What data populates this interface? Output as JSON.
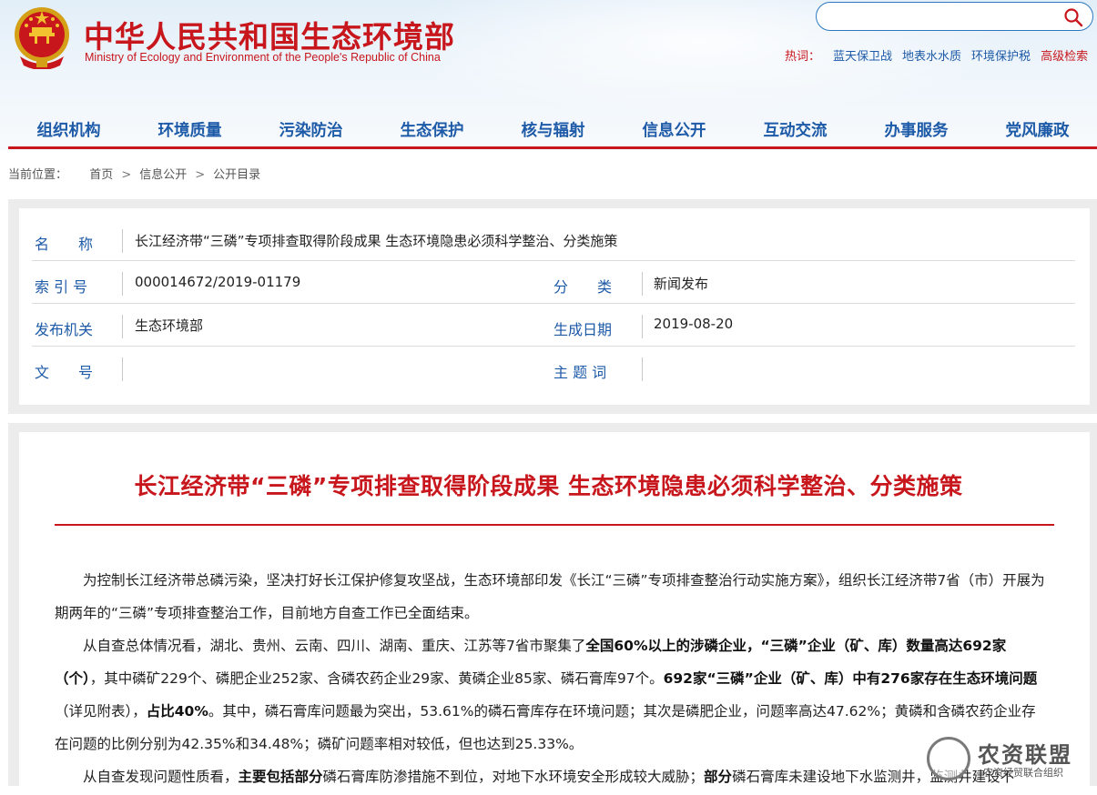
{
  "header": {
    "title_cn": "中华人民共和国生态环境部",
    "title_en": "Ministry of Ecology and Environment of the People's Republic of China",
    "search_placeholder": "",
    "hot_label": "热词：",
    "hot_links": [
      "蓝天保卫战",
      "地表水水质",
      "环境保护税"
    ],
    "advanced_search": "高级检索"
  },
  "nav": {
    "items": [
      "组织机构",
      "环境质量",
      "污染防治",
      "生态保护",
      "核与辐射",
      "信息公开",
      "互动交流",
      "办事服务",
      "党风廉政"
    ]
  },
  "breadcrumb": {
    "label": "当前位置：",
    "items": [
      "首页",
      "信息公开",
      "公开目录"
    ],
    "separator": ">"
  },
  "meta": {
    "name_label": "名　　称",
    "name_value": "长江经济带“三磷”专项排查取得阶段成果 生态环境隐患必须科学整治、分类施策",
    "index_label": "索 引 号",
    "index_value": "000014672/2019-01179",
    "category_label": "分　　类",
    "category_value": "新闻发布",
    "publisher_label": "发布机关",
    "publisher_value": "生态环境部",
    "date_label": "生成日期",
    "date_value": "2019-08-20",
    "docno_label": "文　　号",
    "docno_value": "",
    "subject_label": "主 题 词",
    "subject_value": ""
  },
  "article": {
    "title": "长江经济带“三磷”专项排查取得阶段成果 生态环境隐患必须科学整治、分类施策",
    "p1": "为控制长江经济带总磷污染，坚决打好长江保护修复攻坚战，生态环境部印发《长江“三磷”专项排查整治行动实施方案》，组织长江经济带7省（市）开展为期两年的“三磷”专项排查整治工作，目前地方自查工作已全面结束。",
    "p2_a": "从自查总体情况看，湖北、贵州、云南、四川、湖南、重庆、江苏等7省市聚集了",
    "p2_b": "全国60%以上的涉磷企业，“三磷”企业（矿、库）数量高达692家（个）",
    "p2_c": "，其中磷矿229个、磷肥企业252家、含磷农药企业29家、黄磷企业85家、磷石膏库97个。",
    "p2_d": "692家“三磷”企业（矿、库）中有276家存在生态环境问题",
    "p2_e": "（详见附表），",
    "p2_f": "占比40%",
    "p2_g": "。其中，磷石膏库问题最为突出，53.61%的磷石膏库存在环境问题；其次是磷肥企业，问题率高达47.62%；黄磷和含磷农药企业存在问题的比例分别为42.35%和34.48%；磷矿问题率相对较低，但也达到25.33%。",
    "p3_a": "从自查发现问题性质看，",
    "p3_b": "主要包括部分",
    "p3_c": "磷石膏库防渗措施不到位，对地下水环境安全形成较大威胁；",
    "p3_d": "部分",
    "p3_e": "磷石膏库未建设地下水监测井，监测井建设不"
  },
  "watermark": {
    "text": "农资联盟",
    "sub": "农资经贸联合组织"
  }
}
